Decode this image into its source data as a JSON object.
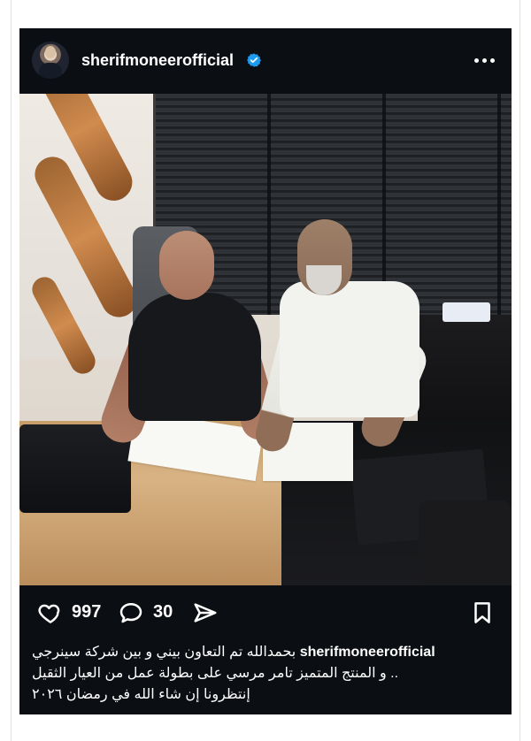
{
  "post": {
    "username": "sherifmoneerofficial",
    "verified_icon": "verified-badge-icon",
    "more_icon": "more-options-icon",
    "likes": "997",
    "comments": "30",
    "caption": {
      "line1": "بحمدالله تم التعاون بيني و بين شركة سينرجي",
      "line2": ".. و المنتج المتميز تامر مرسي على بطولة عمل من العيار الثقيل",
      "line3": "إنتظرونا إن شاء الله في رمضان ٢٠٢٦"
    }
  },
  "colors": {
    "card_background": "#0b0e13",
    "text": "#ffffff",
    "verified": "#1d9bf0"
  },
  "icons": {
    "like": "heart-icon",
    "comment": "comment-icon",
    "share": "share-icon",
    "save": "bookmark-icon"
  }
}
